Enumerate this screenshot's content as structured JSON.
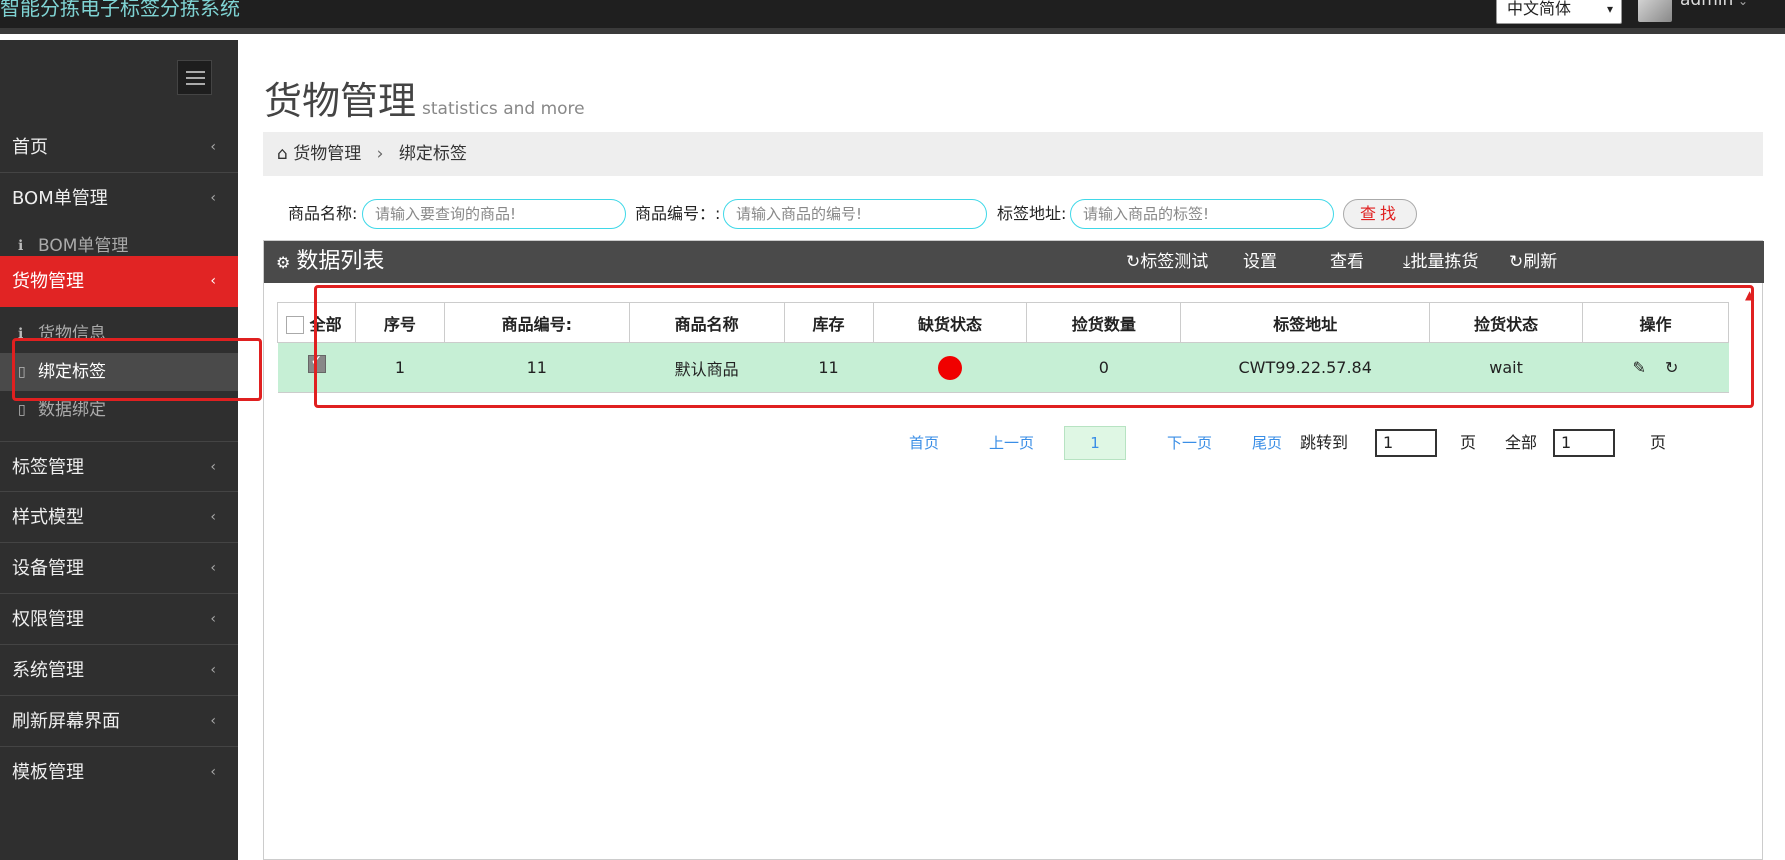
{
  "app_title": "智能分拣电子标签分拣系统",
  "topbar": {
    "language": "中文简体",
    "username": "admin"
  },
  "sidebar": {
    "items": [
      {
        "label": "首页"
      },
      {
        "label": "BOM单管理"
      },
      {
        "label": "货物管理"
      },
      {
        "label": "标签管理"
      },
      {
        "label": "样式模型"
      },
      {
        "label": "设备管理"
      },
      {
        "label": "权限管理"
      },
      {
        "label": "系统管理"
      },
      {
        "label": "刷新屏幕界面"
      },
      {
        "label": "模板管理"
      }
    ],
    "bom_sub": [
      {
        "label": "BOM单管理"
      }
    ],
    "goods_sub": [
      {
        "label": "货物信息"
      },
      {
        "label": "绑定标签"
      },
      {
        "label": "数据绑定"
      }
    ]
  },
  "page": {
    "title": "货物管理",
    "subtitle": "statistics and more"
  },
  "breadcrumb": {
    "home": "货物管理",
    "current": "绑定标签"
  },
  "search": {
    "name_label": "商品名称:",
    "name_placeholder": "请输入要查询的商品!",
    "code_label": "商品编号：:",
    "code_placeholder": "请输入商品的编号!",
    "addr_label": "标签地址:",
    "addr_placeholder": "请输入商品的标签!",
    "find_label": "查找"
  },
  "panel": {
    "title": "数据列表",
    "tools": {
      "tag_test": "标签测试",
      "settings": "设置",
      "view": "查看",
      "batch_pick": "批量拣货",
      "refresh": "刷新"
    }
  },
  "table": {
    "headers": [
      "全部",
      "序号",
      "商品编号:",
      "商品名称",
      "库存",
      "缺货状态",
      "捡货数量",
      "标签地址",
      "捡货状态",
      "操作"
    ],
    "rows": [
      {
        "index": "1",
        "code": "11",
        "name": "默认商品",
        "stock": "11",
        "status_color": "#f00000",
        "pick_qty": "0",
        "tag_addr": "CWT99.22.57.84",
        "pick_status": "wait"
      }
    ]
  },
  "pager": {
    "first": "首页",
    "prev": "上一页",
    "current": "1",
    "next": "下一页",
    "last": "尾页",
    "jump_label": "跳转到",
    "jump_value": "1",
    "page_unit": "页",
    "total_label": "全部",
    "total_value": "1",
    "total_unit": "页"
  },
  "colors": {
    "accent": "#e12424",
    "sidebar": "#2f2f2f",
    "row_bg": "#c6efd5",
    "input_border": "#3fd8e8"
  }
}
